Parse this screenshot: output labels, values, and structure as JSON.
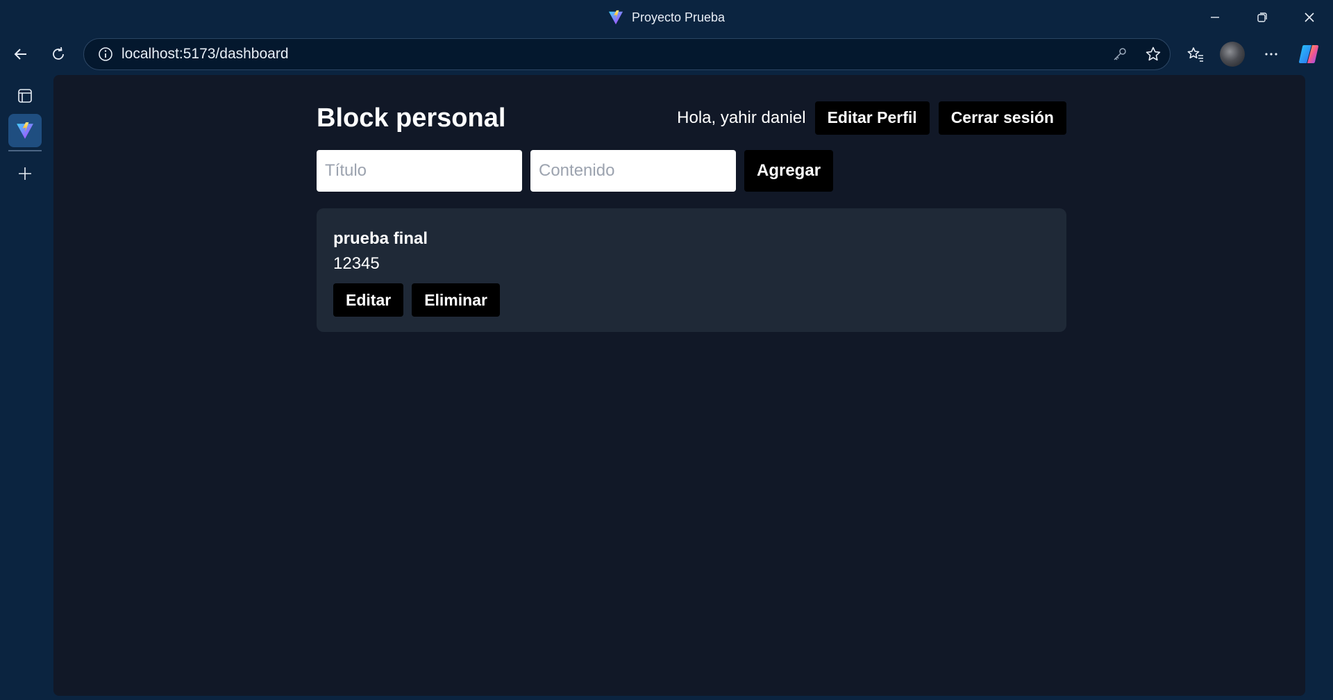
{
  "window": {
    "title": "Proyecto Prueba"
  },
  "browser": {
    "url": "localhost:5173/dashboard"
  },
  "page": {
    "title": "Block personal",
    "greeting": "Hola, yahir daniel",
    "edit_profile_label": "Editar Perfil",
    "logout_label": "Cerrar sesión",
    "form": {
      "title_placeholder": "Título",
      "content_placeholder": "Contenido",
      "add_label": "Agregar"
    },
    "notes": [
      {
        "title": "prueba final",
        "content": "12345",
        "edit_label": "Editar",
        "delete_label": "Eliminar"
      }
    ]
  },
  "colors": {
    "browser_frame": "#0b2440",
    "page_background": "#111827",
    "card_background": "#1f2937",
    "button_background": "#000000"
  },
  "icons": {
    "app": "vite-logo-icon",
    "back": "back-arrow-icon",
    "refresh": "refresh-icon",
    "site_info": "info-icon",
    "password": "key-icon",
    "favorite": "star-icon",
    "favorites": "favorites-icon",
    "more": "more-icon",
    "copilot": "copilot-icon",
    "minimize": "minimize-icon",
    "restore": "restore-icon",
    "close": "close-icon",
    "tab_actions": "tab-actions-icon",
    "new_tab": "plus-icon"
  }
}
